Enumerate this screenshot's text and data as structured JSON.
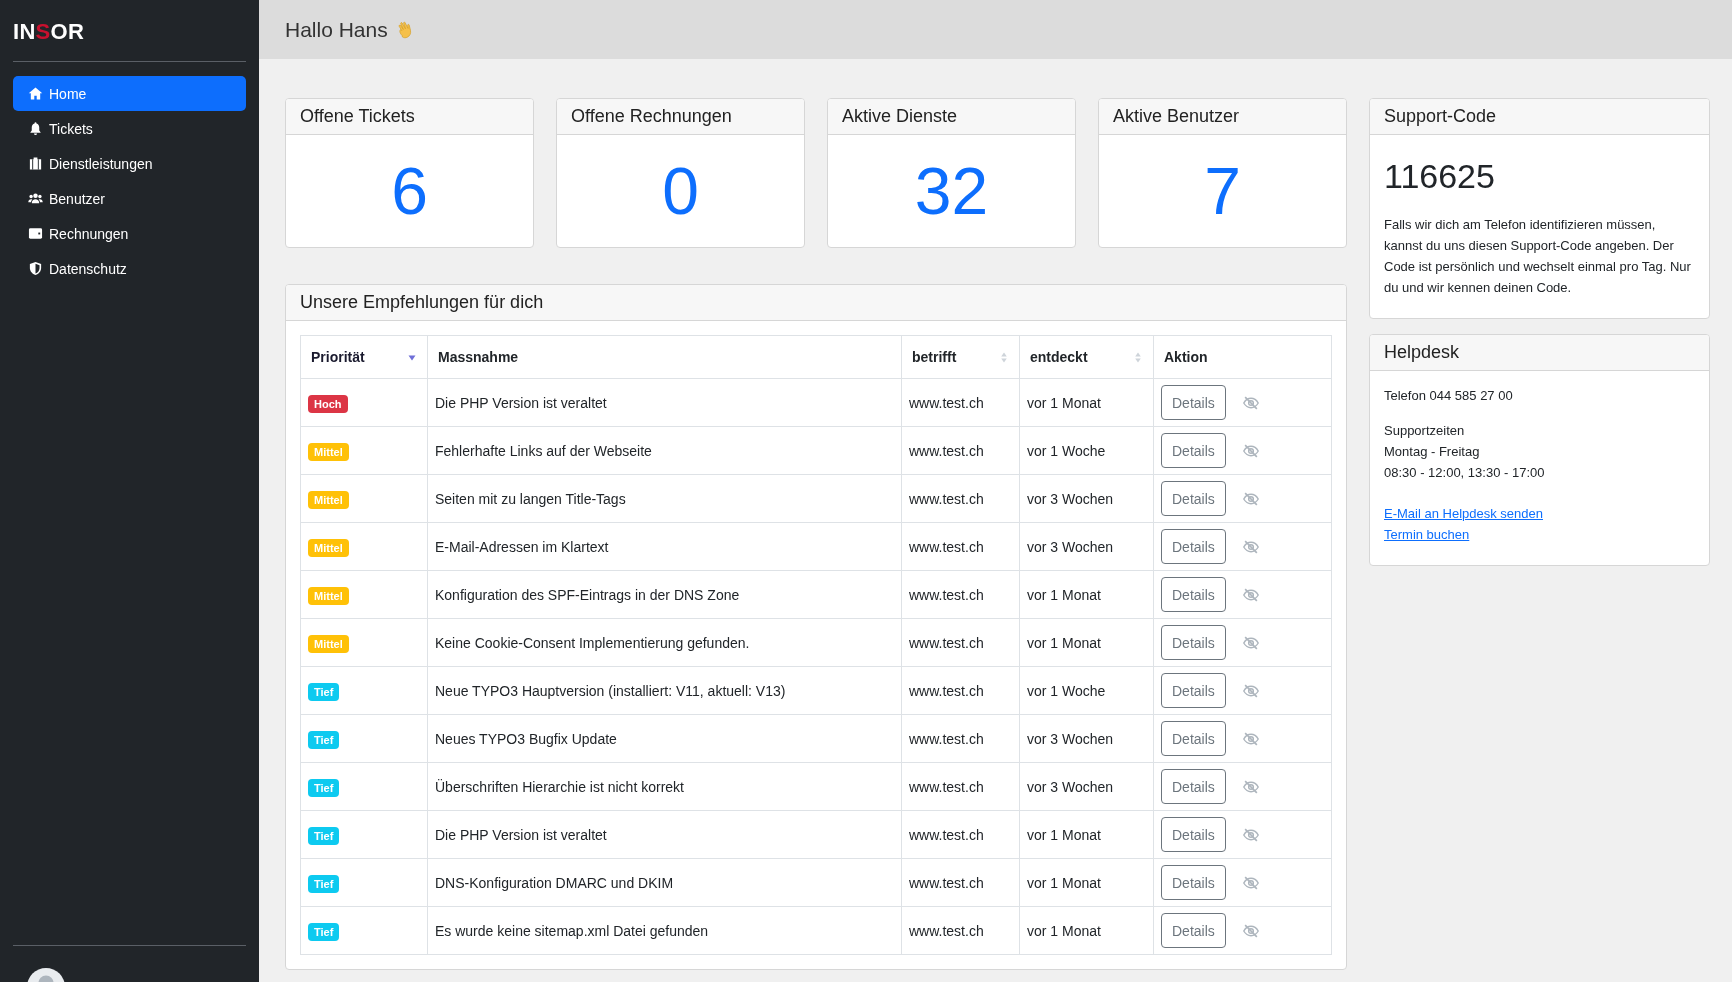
{
  "logo": [
    {
      "text": "IN",
      "accent": false
    },
    {
      "text": "S",
      "accent": true
    },
    {
      "text": "OR",
      "accent": false
    }
  ],
  "sidebar": {
    "items": [
      {
        "label": "Home",
        "selected": true
      },
      {
        "label": "Tickets",
        "selected": false
      },
      {
        "label": "Dienstleistungen",
        "selected": false
      },
      {
        "label": "Benutzer",
        "selected": false
      },
      {
        "label": "Rechnungen",
        "selected": false
      },
      {
        "label": "Datenschutz",
        "selected": false
      }
    ]
  },
  "header": {
    "greeting": "Hallo Hans"
  },
  "stats": [
    {
      "title": "Offene Tickets",
      "value": "6"
    },
    {
      "title": "Offene Rechnungen",
      "value": "0"
    },
    {
      "title": "Aktive Dienste",
      "value": "32"
    },
    {
      "title": "Aktive Benutzer",
      "value": "7"
    }
  ],
  "support_code": {
    "title": "Support-Code",
    "code": "116625",
    "text": "Falls wir dich am Telefon identifizieren müssen, kannst du uns diesen Support-Code angeben. Der Code ist persönlich und wechselt einmal pro Tag. Nur du und wir kennen deinen Code."
  },
  "helpdesk": {
    "title": "Helpdesk",
    "phone": "Telefon 044 585 27 00",
    "hours": [
      "Supportzeiten",
      "Montag - Freitag",
      "08:30 - 12:00, 13:30 - 17:00"
    ],
    "links": [
      "E-Mail an Helpdesk senden",
      "Termin buchen"
    ]
  },
  "recommendations": {
    "title": "Unsere Empfehlungen für dich",
    "columns": [
      {
        "label": "Priorität",
        "sortable": true,
        "sorted": true
      },
      {
        "label": "Massnahme",
        "sortable": false,
        "sorted": false
      },
      {
        "label": "betrifft",
        "sortable": true,
        "sorted": false
      },
      {
        "label": "entdeckt",
        "sortable": true,
        "sorted": false
      },
      {
        "label": "Aktion",
        "sortable": false,
        "sorted": false
      }
    ],
    "rows": [
      {
        "priority": "Hoch",
        "color": "#dc3545",
        "measure": "Die PHP Version ist veraltet",
        "target": "www.test.ch",
        "found": "vor 1 Monat",
        "action": "Details"
      },
      {
        "priority": "Mittel",
        "color": "#ffc107",
        "measure": "Fehlerhafte Links auf der Webseite",
        "target": "www.test.ch",
        "found": "vor 1 Woche",
        "action": "Details"
      },
      {
        "priority": "Mittel",
        "color": "#ffc107",
        "measure": "Seiten mit zu langen Title-Tags",
        "target": "www.test.ch",
        "found": "vor 3 Wochen",
        "action": "Details"
      },
      {
        "priority": "Mittel",
        "color": "#ffc107",
        "measure": "E-Mail-Adressen im Klartext",
        "target": "www.test.ch",
        "found": "vor 3 Wochen",
        "action": "Details"
      },
      {
        "priority": "Mittel",
        "color": "#ffc107",
        "measure": "Konfiguration des SPF-Eintrags in der DNS Zone",
        "target": "www.test.ch",
        "found": "vor 1 Monat",
        "action": "Details"
      },
      {
        "priority": "Mittel",
        "color": "#ffc107",
        "measure": "Keine Cookie-Consent Implementierung gefunden.",
        "target": "www.test.ch",
        "found": "vor 1 Monat",
        "action": "Details"
      },
      {
        "priority": "Tief",
        "color": "#0dcaf0",
        "measure": "Neue TYPO3 Hauptversion (installiert: V11, aktuell: V13)",
        "target": "www.test.ch",
        "found": "vor 1 Woche",
        "action": "Details"
      },
      {
        "priority": "Tief",
        "color": "#0dcaf0",
        "measure": "Neues TYPO3 Bugfix Update",
        "target": "www.test.ch",
        "found": "vor 3 Wochen",
        "action": "Details"
      },
      {
        "priority": "Tief",
        "color": "#0dcaf0",
        "measure": "Überschriften Hierarchie ist nicht korrekt",
        "target": "www.test.ch",
        "found": "vor 3 Wochen",
        "action": "Details"
      },
      {
        "priority": "Tief",
        "color": "#0dcaf0",
        "measure": "Die PHP Version ist veraltet",
        "target": "www.test.ch",
        "found": "vor 1 Monat",
        "action": "Details"
      },
      {
        "priority": "Tief",
        "color": "#0dcaf0",
        "measure": "DNS-Konfiguration DMARC und DKIM",
        "target": "www.test.ch",
        "found": "vor 1 Monat",
        "action": "Details"
      },
      {
        "priority": "Tief",
        "color": "#0dcaf0",
        "measure": "Es wurde keine sitemap.xml Datei gefunden",
        "target": "www.test.ch",
        "found": "vor 1 Monat",
        "action": "Details"
      }
    ]
  }
}
